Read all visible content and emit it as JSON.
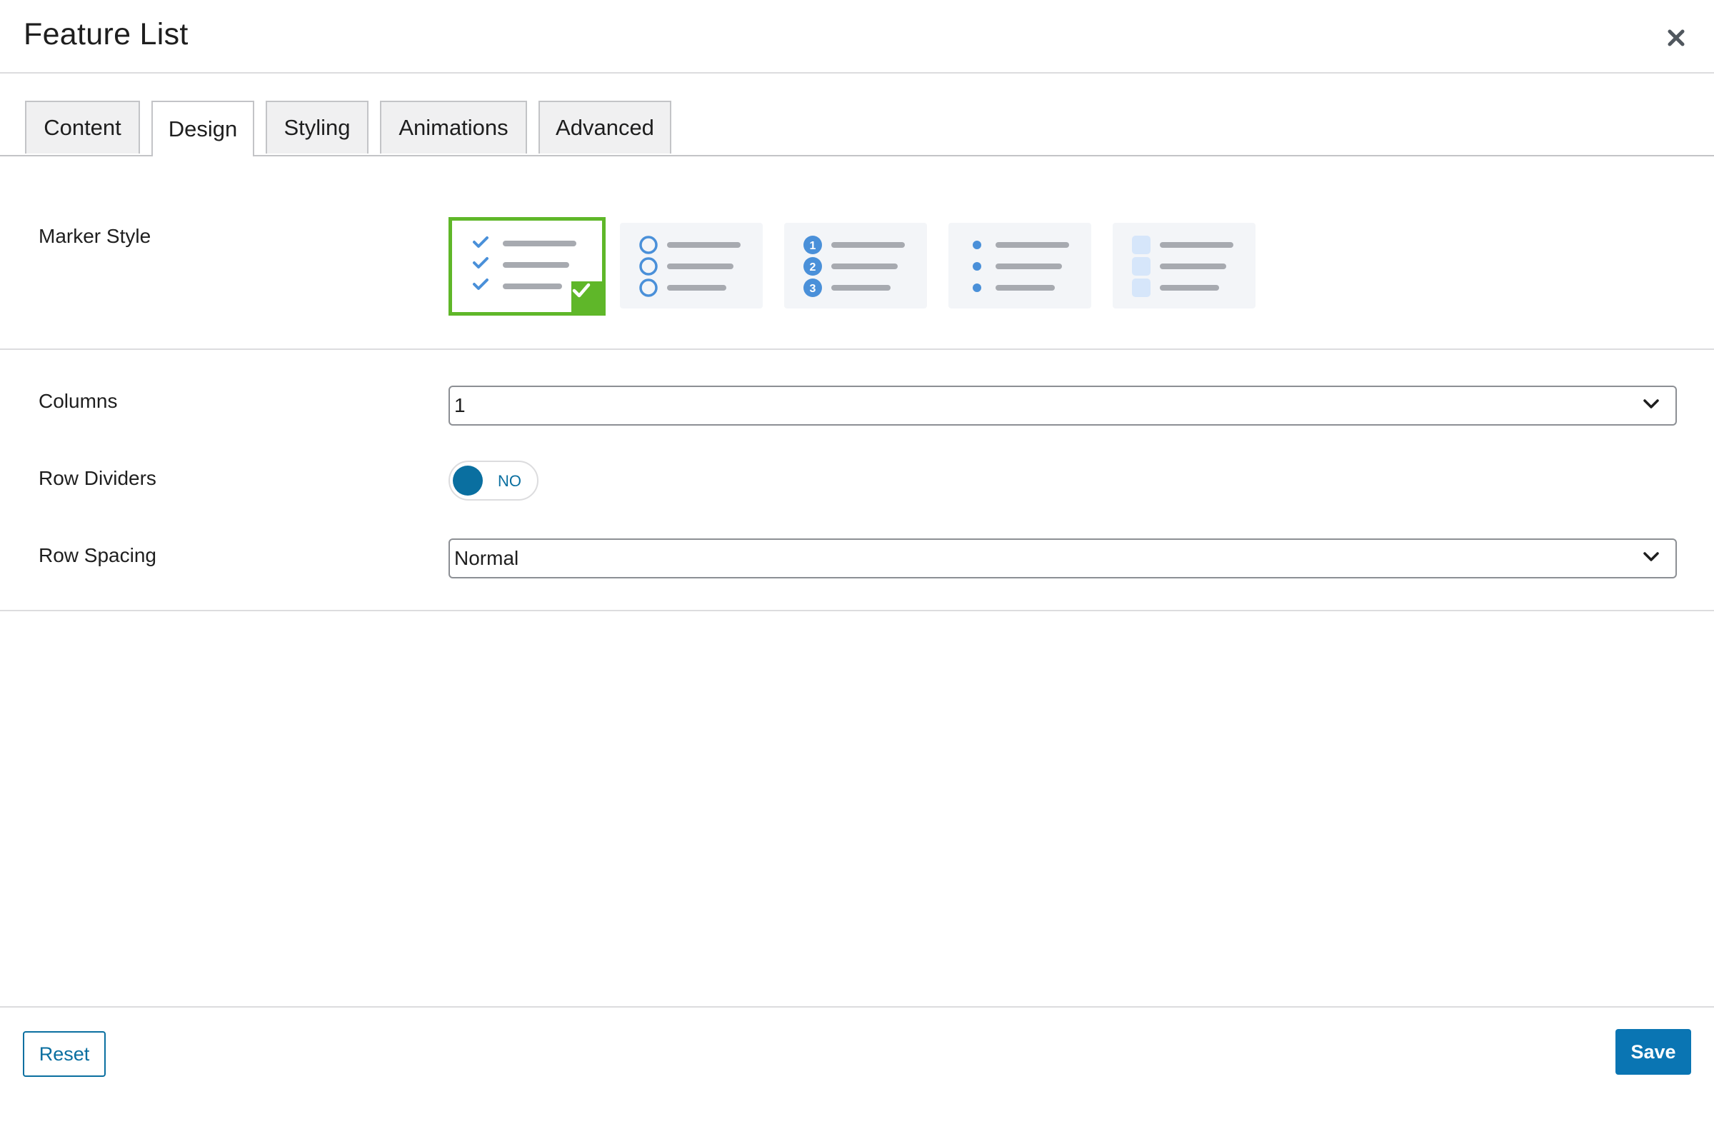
{
  "dialog": {
    "title": "Feature List",
    "close_icon": "close-icon"
  },
  "tabs": [
    {
      "label": "Content",
      "active": false
    },
    {
      "label": "Design",
      "active": true
    },
    {
      "label": "Styling",
      "active": false
    },
    {
      "label": "Animations",
      "active": false
    },
    {
      "label": "Advanced",
      "active": false
    }
  ],
  "design": {
    "marker_style": {
      "label": "Marker Style",
      "selected": "checkmark",
      "options": [
        "checkmark",
        "circle",
        "numbered",
        "bullet",
        "square"
      ],
      "numbered_markers": [
        "1",
        "2",
        "3"
      ]
    },
    "columns": {
      "label": "Columns",
      "value": "1"
    },
    "row_dividers": {
      "label": "Row Dividers",
      "value": "NO"
    },
    "row_spacing": {
      "label": "Row Spacing",
      "value": "Normal"
    }
  },
  "footer": {
    "reset_label": "Reset",
    "save_label": "Save"
  },
  "colors": {
    "accent": "#0a75b3",
    "selected_border": "#5fb729",
    "marker_blue": "#4a90d9",
    "line_gray": "#a7aab0"
  }
}
